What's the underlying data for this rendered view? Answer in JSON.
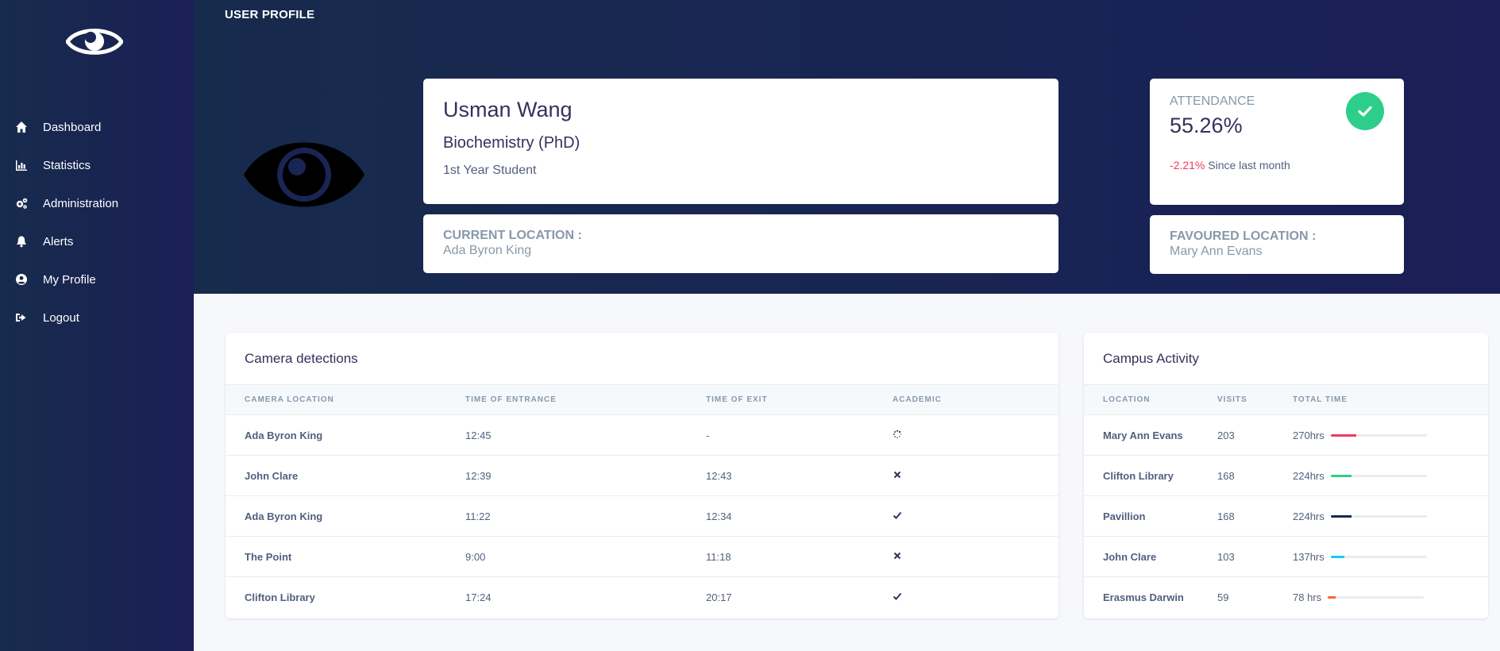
{
  "sidebar": {
    "items": [
      {
        "label": "Dashboard",
        "icon": "home-icon"
      },
      {
        "label": "Statistics",
        "icon": "bar-chart-icon"
      },
      {
        "label": "Administration",
        "icon": "cogs-icon"
      },
      {
        "label": "Alerts",
        "icon": "bell-icon"
      },
      {
        "label": "My Profile",
        "icon": "user-circle-icon"
      },
      {
        "label": "Logout",
        "icon": "sign-out-icon"
      }
    ]
  },
  "header": {
    "title": "USER PROFILE"
  },
  "profile": {
    "name": "Usman Wang",
    "degree": "Biochemistry (PhD)",
    "year": "1st Year Student"
  },
  "current_location": {
    "caption": "CURRENT LOCATION :",
    "value": "Ada Byron King"
  },
  "attendance": {
    "title": "ATTENDANCE",
    "value": "55.26%",
    "change": "-2.21%",
    "since": "Since last month",
    "icon": "check-icon",
    "accent": "#2dce89"
  },
  "favoured_location": {
    "caption": "FAVOURED LOCATION :",
    "value": "Mary Ann Evans"
  },
  "camera": {
    "title": "Camera detections",
    "headers": [
      "CAMERA LOCATION",
      "TIME OF ENTRANCE",
      "TIME OF EXIT",
      "ACADEMIC"
    ],
    "rows": [
      {
        "location": "Ada Byron King",
        "entrance": "12:45",
        "exit": "-",
        "academic": "pending"
      },
      {
        "location": "John Clare",
        "entrance": "12:39",
        "exit": "12:43",
        "academic": "no"
      },
      {
        "location": "Ada Byron King",
        "entrance": "11:22",
        "exit": "12:34",
        "academic": "yes"
      },
      {
        "location": "The Point",
        "entrance": "9:00",
        "exit": "11:18",
        "academic": "no"
      },
      {
        "location": "Clifton Library",
        "entrance": "17:24",
        "exit": "20:17",
        "academic": "yes"
      }
    ]
  },
  "activity": {
    "title": "Campus Activity",
    "headers": [
      "LOCATION",
      "VISITS",
      "TOTAL TIME"
    ],
    "rows": [
      {
        "location": "Mary Ann Evans",
        "visits": "203",
        "time": "270hrs",
        "fraction": 0.27,
        "color": "#f5365c"
      },
      {
        "location": "Clifton Library",
        "visits": "168",
        "time": "224hrs",
        "fraction": 0.22,
        "color": "#2dce89"
      },
      {
        "location": "Pavillion",
        "visits": "168",
        "time": "224hrs",
        "fraction": 0.22,
        "color": "#172b4d"
      },
      {
        "location": "John Clare",
        "visits": "103",
        "time": "137hrs",
        "fraction": 0.14,
        "color": "#11cdef"
      },
      {
        "location": "Erasmus Darwin",
        "visits": "59",
        "time": "78 hrs",
        "fraction": 0.08,
        "color": "#fb6340"
      }
    ]
  }
}
